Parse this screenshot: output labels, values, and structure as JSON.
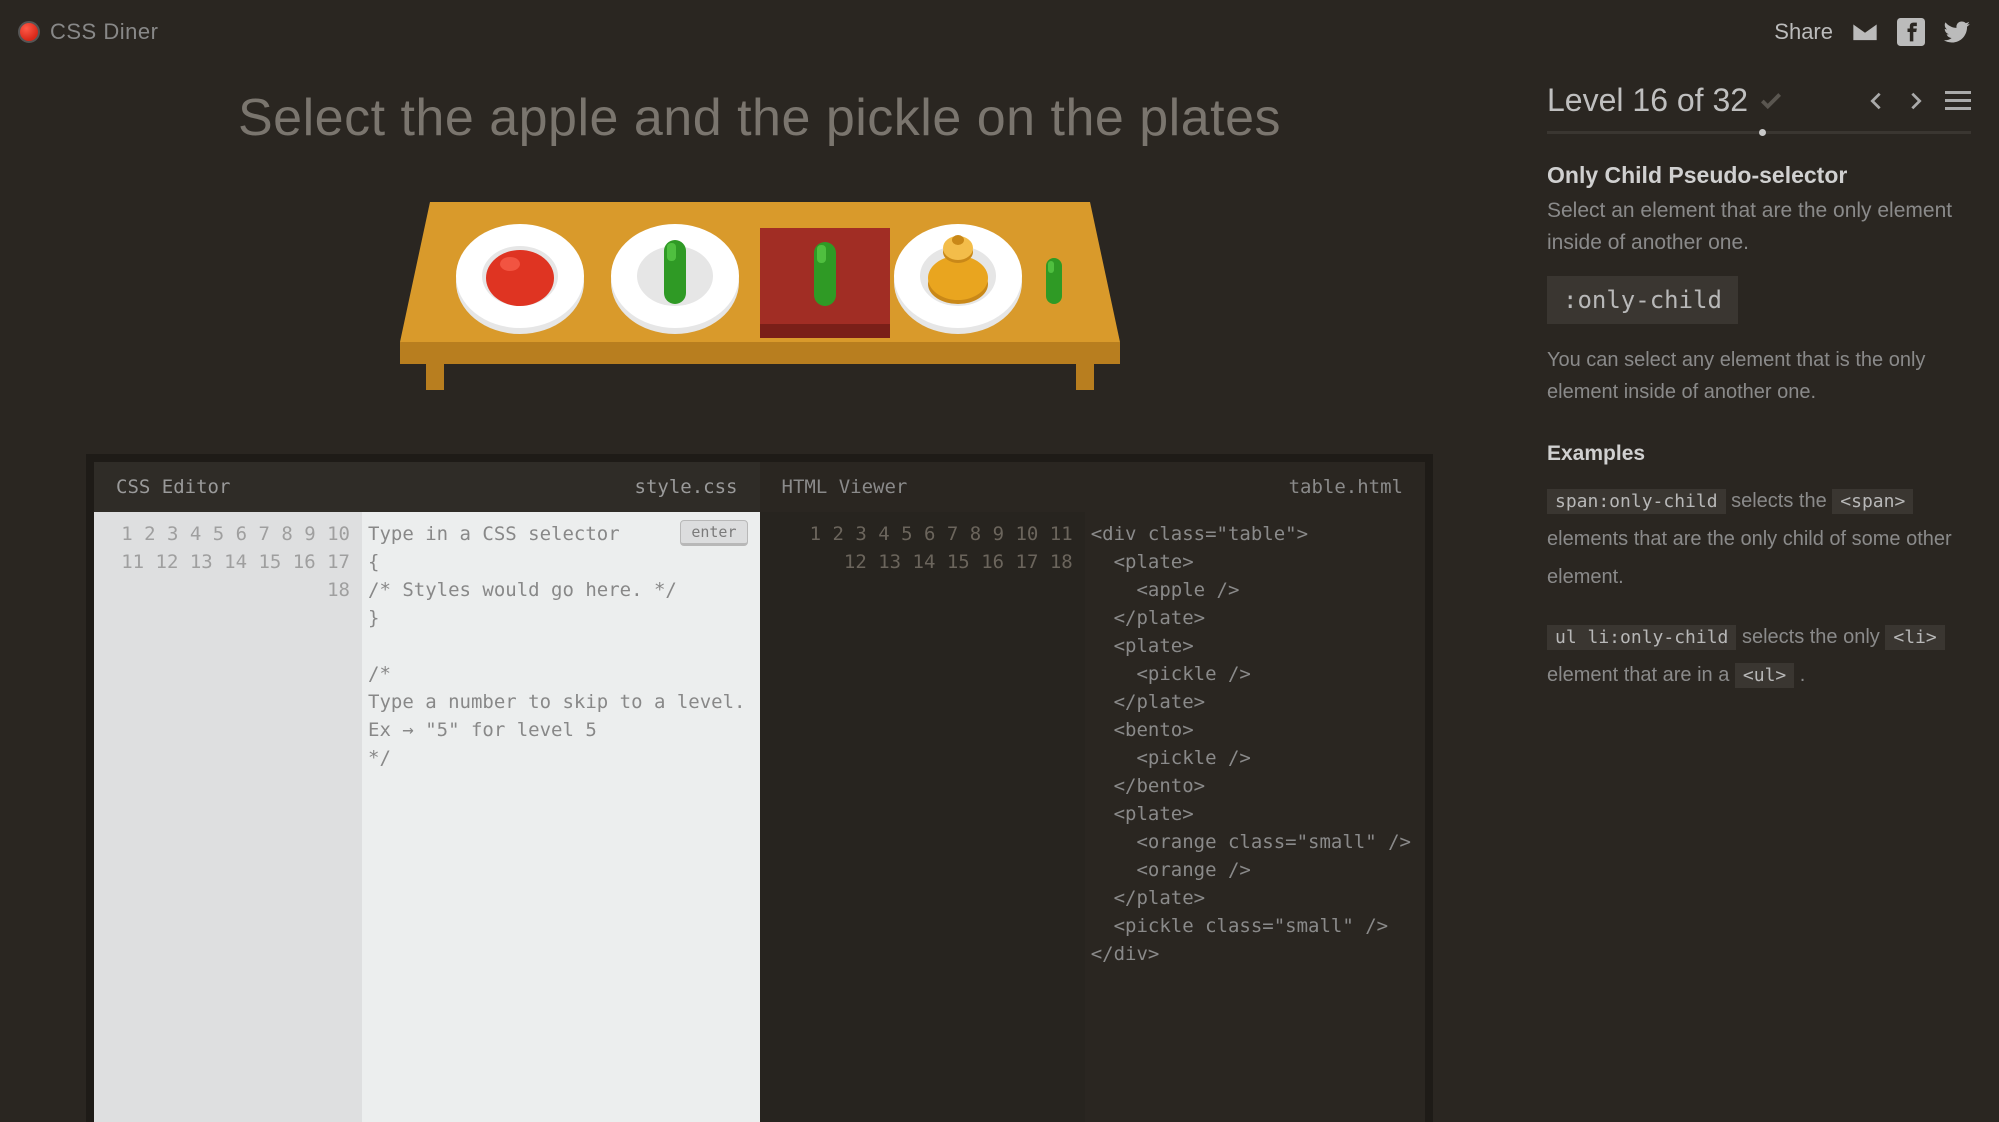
{
  "header": {
    "app_name": "CSS Diner",
    "share_label": "Share"
  },
  "instruction": "Select the apple and the pickle on the plates",
  "editors": {
    "css": {
      "title": "CSS Editor",
      "filename": "style.css",
      "placeholder": "Type in a CSS selector",
      "enter_label": "enter",
      "lines": [
        "Type in a CSS selector",
        "{",
        "/* Styles would go here. */",
        "}",
        "",
        "/*",
        "Type a number to skip to a level.",
        "Ex → \"5\" for level 5",
        "*/",
        "",
        "",
        "",
        "",
        "",
        "",
        "",
        "",
        ""
      ]
    },
    "html": {
      "title": "HTML Viewer",
      "filename": "table.html",
      "lines": [
        "<div class=\"table\">",
        "  <plate>",
        "    <apple />",
        "  </plate>",
        "  <plate>",
        "    <pickle />",
        "  </plate>",
        "  <bento>",
        "    <pickle />",
        "  </bento>",
        "  <plate>",
        "    <orange class=\"small\" />",
        "    <orange />",
        "  </plate>",
        "  <pickle class=\"small\" />",
        "</div>",
        "",
        ""
      ]
    }
  },
  "sidebar": {
    "level_label": "Level 16 of 32",
    "section_title": "Only Child Pseudo-selector",
    "section_subtitle": "Select an element that are the only element inside of another one.",
    "selector_code": ":only-child",
    "description": "You can select any element that is the only element inside of another one.",
    "examples_label": "Examples",
    "examples": [
      {
        "code1": "span:only-child",
        "mid1": " selects the ",
        "code2": "<span>",
        "tail": " elements that are the only child of some other element."
      },
      {
        "code1": "ul li:only-child",
        "mid1": " selects the only ",
        "code2": "<li>",
        "mid2": " element that are in a ",
        "code3": "<ul>",
        "tail": " ."
      }
    ]
  },
  "colors": {
    "table": "#d99a2b",
    "table_edge": "#b87e1f",
    "plate": "#ffffff",
    "plate_inner": "#e6e6e6",
    "apple": "#df3422",
    "apple_hi": "#f25441",
    "pickle": "#2f9a25",
    "pickle_hi": "#4fbf3f",
    "bento": "#a12d24",
    "bento_dark": "#7a1f18",
    "orange": "#e9a51f",
    "orange_hi": "#f3bd4a"
  }
}
